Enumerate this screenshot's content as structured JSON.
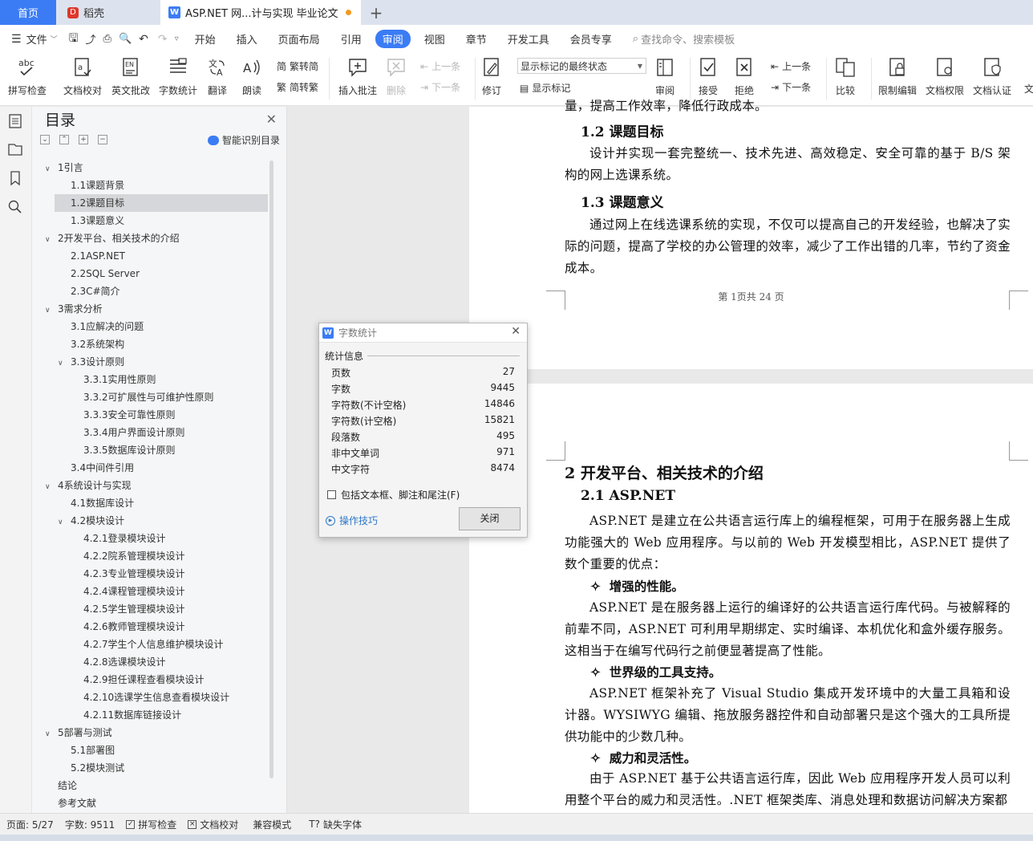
{
  "tabs": {
    "home": "首页",
    "daoke": "稻壳",
    "doc": "ASP.NET 网...计与实现 毕业论文",
    "new_tab": "+"
  },
  "menu": {
    "file": "文件",
    "items": [
      "开始",
      "插入",
      "页面布局",
      "引用",
      "审阅",
      "视图",
      "章节",
      "开发工具",
      "会员专享"
    ],
    "active": "审阅",
    "search_placeholder": "查找命令、搜索模板"
  },
  "ribbon": {
    "spell_check": "拼写检查",
    "doc_proof": "文档校对",
    "en_grading": "英文批改",
    "word_count": "字数统计",
    "translate": "翻译",
    "read_aloud": "朗读",
    "to_simplified_t": "繁转简",
    "to_traditional": "简转繁",
    "insert_comment": "插入批注",
    "delete": "删除",
    "prev_comment": "上一条",
    "next_comment": "下一条",
    "revise": "修订",
    "markup_select": "显示标记的最终状态",
    "show_markup": "显示标记",
    "review": "审阅",
    "accept": "接受",
    "reject": "拒绝",
    "prev_change": "上一条",
    "next_change": "下一条",
    "compare": "比较",
    "restrict": "限制编辑",
    "permission": "文档权限",
    "certify": "文档认证",
    "more": "文"
  },
  "nav": {
    "title": "目录",
    "smart_toc": "智能识别目录",
    "items": [
      {
        "text": "1引言",
        "level": 1,
        "caret": "v"
      },
      {
        "text": "1.1课题背景",
        "level": 2
      },
      {
        "text": "1.2课题目标",
        "level": 2,
        "selected": true
      },
      {
        "text": "1.3课题意义",
        "level": 2
      },
      {
        "text": "2开发平台、相关技术的介绍",
        "level": 1,
        "caret": "v"
      },
      {
        "text": "2.1ASP.NET",
        "level": 2
      },
      {
        "text": "2.2SQL Server",
        "level": 2
      },
      {
        "text": "2.3C#简介",
        "level": 2
      },
      {
        "text": "3需求分析",
        "level": 1,
        "caret": "v"
      },
      {
        "text": "3.1应解决的问题",
        "level": 2
      },
      {
        "text": "3.2系统架构",
        "level": 2
      },
      {
        "text": "3.3设计原则",
        "level": 2,
        "caret": "v"
      },
      {
        "text": "3.3.1实用性原则",
        "level": 3
      },
      {
        "text": "3.3.2可扩展性与可维护性原则",
        "level": 3
      },
      {
        "text": "3.3.3安全可靠性原则",
        "level": 3
      },
      {
        "text": "3.3.4用户界面设计原则",
        "level": 3
      },
      {
        "text": "3.3.5数据库设计原则",
        "level": 3
      },
      {
        "text": "3.4中间件引用",
        "level": 2
      },
      {
        "text": "4系统设计与实现",
        "level": 1,
        "caret": "v"
      },
      {
        "text": "4.1数据库设计",
        "level": 2
      },
      {
        "text": "4.2模块设计",
        "level": 2,
        "caret": "v"
      },
      {
        "text": "4.2.1登录模块设计",
        "level": 3
      },
      {
        "text": "4.2.2院系管理模块设计",
        "level": 3
      },
      {
        "text": "4.2.3专业管理模块设计",
        "level": 3
      },
      {
        "text": "4.2.4课程管理模块设计",
        "level": 3
      },
      {
        "text": "4.2.5学生管理模块设计",
        "level": 3
      },
      {
        "text": "4.2.6教师管理模块设计",
        "level": 3
      },
      {
        "text": "4.2.7学生个人信息维护模块设计",
        "level": 3
      },
      {
        "text": "4.2.8选课模块设计",
        "level": 3
      },
      {
        "text": "4.2.9担任课程查看模块设计",
        "level": 3
      },
      {
        "text": "4.2.10选课学生信息查看模块设计",
        "level": 3
      },
      {
        "text": "4.2.11数据库链接设计",
        "level": 3
      },
      {
        "text": "5部署与测试",
        "level": 1,
        "caret": "v"
      },
      {
        "text": "5.1部署图",
        "level": 2
      },
      {
        "text": "5.2模块测试",
        "level": 2
      },
      {
        "text": "结论",
        "level": 1
      },
      {
        "text": "参考文献",
        "level": 1
      }
    ]
  },
  "document": {
    "page1": {
      "top_cut": "量，提高工作效率，降低行政成本。",
      "h_1_2": "1.2   课题目标",
      "p_1_2": "设计并实现一套完整统一、技术先进、高效稳定、安全可靠的基于 B/S 架构的网上选课系统。",
      "h_1_3": "1.3   课题意义",
      "p_1_3": "通过网上在线选课系统的实现，不仅可以提高自己的开发经验，也解决了实际的问题，提高了学校的办公管理的效率，减少了工作出错的几率，节约了资金成本。",
      "footer": "第 1页共 24 页"
    },
    "page2": {
      "h_2": "2   开发平台、相关技术的介绍",
      "h_2_1": "2.1   ASP.NET",
      "p_intro": "ASP.NET 是建立在公共语言运行库上的编程框架，可用于在服务器上生成功能强大的 Web 应用程序。与以前的 Web 开发模型相比，ASP.NET 提供了数个重要的优点：",
      "b1": "增强的性能。",
      "p_b1": "ASP.NET 是在服务器上运行的编译好的公共语言运行库代码。与被解释的前辈不同，ASP.NET 可利用早期绑定、实时编译、本机优化和盒外缓存服务。这相当于在编写代码行之前便显著提高了性能。",
      "b2": "世界级的工具支持。",
      "p_b2": "ASP.NET 框架补充了 Visual Studio 集成开发环境中的大量工具箱和设计器。WYSIWYG 编辑、拖放服务器控件和自动部署只是这个强大的工具所提供功能中的少数几种。",
      "b3": "威力和灵活性。",
      "p_b3": "由于 ASP.NET 基于公共语言运行库，因此 Web 应用程序开发人员可以利用整个平台的威力和灵活性。.NET 框架类库、消息处理和数据访问解决方案都"
    }
  },
  "dialog": {
    "title": "字数统计",
    "section": "统计信息",
    "rows": [
      {
        "label": "页数",
        "value": "27"
      },
      {
        "label": "字数",
        "value": "9445"
      },
      {
        "label": "字符数(不计空格)",
        "value": "14846"
      },
      {
        "label": "字符数(计空格)",
        "value": "15821"
      },
      {
        "label": "段落数",
        "value": "495"
      },
      {
        "label": "非中文单词",
        "value": "971"
      },
      {
        "label": "中文字符",
        "value": "8474"
      }
    ],
    "checkbox_label": "包括文本框、脚注和尾注(F)",
    "tips": "操作技巧",
    "close_button": "关闭"
  },
  "status": {
    "page": "页面: 5/27",
    "words": "字数: 9511",
    "spell": "拼写检查",
    "proof": "文档校对",
    "compat": "兼容模式",
    "missing_font": "缺失字体"
  },
  "colors": {
    "accent": "#3b7cf5",
    "tab_dot": "#f29a1d",
    "selected_row": "#d5d7da"
  }
}
